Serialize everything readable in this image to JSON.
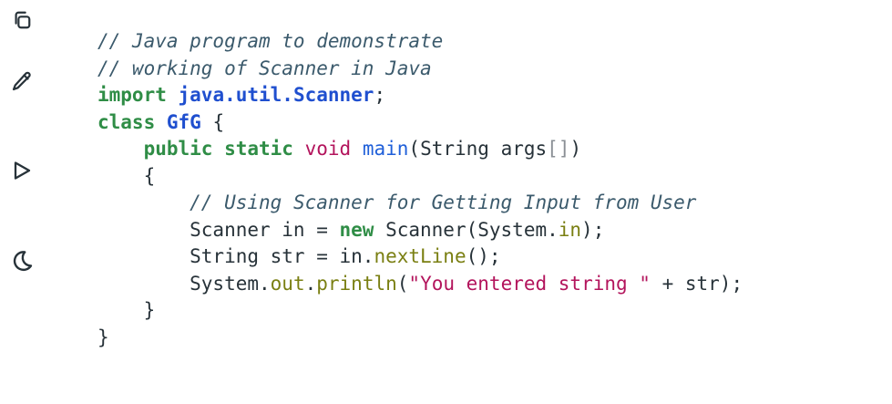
{
  "toolbar": {
    "items": [
      {
        "name": "copy",
        "icon": "copy-icon"
      },
      {
        "name": "edit",
        "icon": "pencil-icon"
      },
      {
        "name": "run",
        "icon": "play-icon"
      },
      {
        "name": "theme",
        "icon": "moon-icon"
      }
    ],
    "icon_color": "#273239"
  },
  "code": {
    "language": "java",
    "lines": [
      [
        {
          "t": "comment",
          "v": "// Java program to demonstrate"
        }
      ],
      [
        {
          "t": "comment",
          "v": "// working of Scanner in Java"
        }
      ],
      [
        {
          "t": "keyword",
          "v": "import"
        },
        {
          "t": "plain",
          "v": " "
        },
        {
          "t": "package",
          "v": "java.util.Scanner"
        },
        {
          "t": "plain",
          "v": ";"
        }
      ],
      [
        {
          "t": "keyword",
          "v": "class"
        },
        {
          "t": "plain",
          "v": " "
        },
        {
          "t": "classname",
          "v": "GfG"
        },
        {
          "t": "plain",
          "v": " {"
        }
      ],
      [
        {
          "t": "plain",
          "v": "    "
        },
        {
          "t": "keyword",
          "v": "public"
        },
        {
          "t": "plain",
          "v": " "
        },
        {
          "t": "keyword",
          "v": "static"
        },
        {
          "t": "plain",
          "v": " "
        },
        {
          "t": "type",
          "v": "void"
        },
        {
          "t": "plain",
          "v": " "
        },
        {
          "t": "method",
          "v": "main"
        },
        {
          "t": "plain",
          "v": "(String args"
        },
        {
          "t": "bracket",
          "v": "[]"
        },
        {
          "t": "plain",
          "v": ")"
        }
      ],
      [
        {
          "t": "plain",
          "v": "    {"
        }
      ],
      [
        {
          "t": "plain",
          "v": "        "
        },
        {
          "t": "comment",
          "v": "// Using Scanner for Getting Input from User"
        }
      ],
      [
        {
          "t": "plain",
          "v": "        Scanner in = "
        },
        {
          "t": "keyword",
          "v": "new"
        },
        {
          "t": "plain",
          "v": " Scanner(System."
        },
        {
          "t": "field",
          "v": "in"
        },
        {
          "t": "plain",
          "v": ");"
        }
      ],
      [
        {
          "t": "plain",
          "v": "        String str = in."
        },
        {
          "t": "field",
          "v": "nextLine"
        },
        {
          "t": "plain",
          "v": "();"
        }
      ],
      [
        {
          "t": "plain",
          "v": "        System."
        },
        {
          "t": "field",
          "v": "out"
        },
        {
          "t": "plain",
          "v": "."
        },
        {
          "t": "field",
          "v": "println"
        },
        {
          "t": "plain",
          "v": "("
        },
        {
          "t": "string",
          "v": "\"You entered string \""
        },
        {
          "t": "plain",
          "v": " + str);"
        }
      ],
      [
        {
          "t": "plain",
          "v": "    }"
        }
      ],
      [
        {
          "t": "plain",
          "v": "}"
        }
      ]
    ]
  }
}
